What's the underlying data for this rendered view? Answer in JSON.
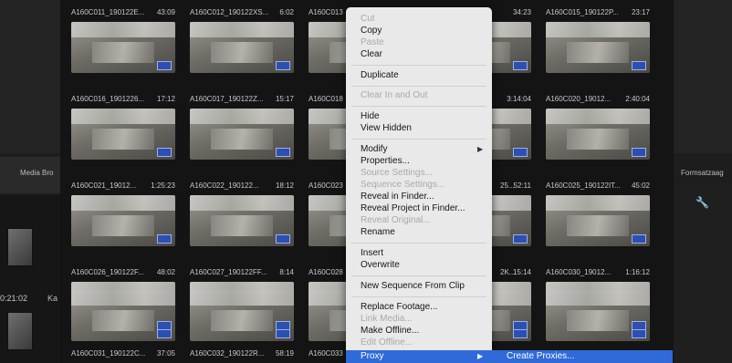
{
  "left_panel": {
    "tab_label": "Media Bro",
    "timecode": "0:21:02",
    "short_label": "Ka"
  },
  "right_panel": {
    "tab_label": "Formsatzaag"
  },
  "clips": [
    {
      "name": "A160C011_190122E...",
      "duration": "43:09"
    },
    {
      "name": "A160C012_190122XS...",
      "duration": "6:02"
    },
    {
      "name": "A160C013",
      "duration": ""
    },
    {
      "name": "",
      "duration": "34:23"
    },
    {
      "name": "A160C015_190122P...",
      "duration": "23:17"
    },
    {
      "name": "A160C016_1901226...",
      "duration": "17:12"
    },
    {
      "name": "A160C017_190122Z...",
      "duration": "15:17"
    },
    {
      "name": "A160C018",
      "duration": ""
    },
    {
      "name": "",
      "duration": "3:14:04"
    },
    {
      "name": "A160C020_19012...",
      "duration": "2:40:04"
    },
    {
      "name": "A160C021_19012...",
      "duration": "1:25:23"
    },
    {
      "name": "A160C022_190122...",
      "duration": "18:12"
    },
    {
      "name": "A160C023",
      "duration": ""
    },
    {
      "name": "25...",
      "duration": "52:11"
    },
    {
      "name": "A160C025_190122IT...",
      "duration": "45:02"
    },
    {
      "name": "A160C026_190122F...",
      "duration": "48:02"
    },
    {
      "name": "A160C027_190122FF...",
      "duration": "8:14"
    },
    {
      "name": "A160C028",
      "duration": ""
    },
    {
      "name": "2K...",
      "duration": "15:14"
    },
    {
      "name": "A160C030_19012...",
      "duration": "1:16:12"
    },
    {
      "name": "A160C031_190122C...",
      "duration": "37:05"
    },
    {
      "name": "A160C032_190122R...",
      "duration": "58:19"
    },
    {
      "name": "A160C033",
      "duration": ""
    },
    {
      "name": "",
      "duration": ""
    },
    {
      "name": "",
      "duration": ""
    }
  ],
  "context_menu": {
    "items": [
      {
        "label": "Cut",
        "enabled": false
      },
      {
        "label": "Copy",
        "enabled": true
      },
      {
        "label": "Paste",
        "enabled": false
      },
      {
        "label": "Clear",
        "enabled": true
      },
      {
        "label": "Duplicate",
        "enabled": true
      },
      {
        "label": "Clear In and Out",
        "enabled": false
      },
      {
        "label": "Hide",
        "enabled": true
      },
      {
        "label": "View Hidden",
        "enabled": true
      },
      {
        "label": "Modify",
        "enabled": true
      },
      {
        "label": "Properties...",
        "enabled": true
      },
      {
        "label": "Source Settings...",
        "enabled": false
      },
      {
        "label": "Sequence Settings...",
        "enabled": false
      },
      {
        "label": "Reveal in Finder...",
        "enabled": true
      },
      {
        "label": "Reveal Project in Finder...",
        "enabled": true
      },
      {
        "label": "Reveal Original...",
        "enabled": false
      },
      {
        "label": "Rename",
        "enabled": true
      },
      {
        "label": "Insert",
        "enabled": true
      },
      {
        "label": "Overwrite",
        "enabled": true
      },
      {
        "label": "New Sequence From Clip",
        "enabled": true
      },
      {
        "label": "Replace Footage...",
        "enabled": true
      },
      {
        "label": "Link Media...",
        "enabled": false
      },
      {
        "label": "Make Offline...",
        "enabled": true
      },
      {
        "label": "Edit Offline...",
        "enabled": false
      },
      {
        "label": "Proxy",
        "enabled": true
      }
    ],
    "submenu_arrow": "▶"
  },
  "proxy_submenu": {
    "items": [
      {
        "label": "Create Proxies..."
      }
    ]
  },
  "colors": {
    "menu_bg": "#e9e9e9",
    "highlight": "#2f6ad8",
    "grid_bg": "#141414"
  }
}
